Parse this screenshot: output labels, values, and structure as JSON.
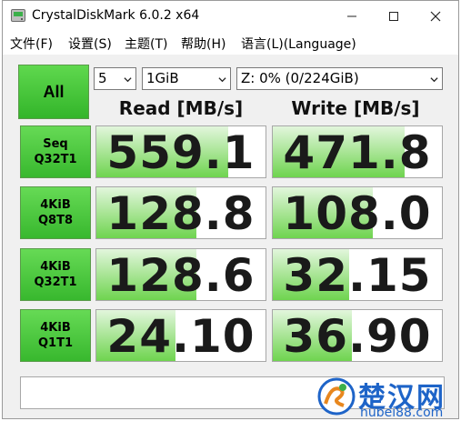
{
  "window": {
    "title": "CrystalDiskMark 6.0.2 x64",
    "controls": {
      "minimize": "minimize-icon",
      "maximize": "maximize-icon",
      "close": "close-icon"
    }
  },
  "menu": [
    {
      "label": "文件(F)"
    },
    {
      "label": "设置(S)"
    },
    {
      "label": "主题(T)"
    },
    {
      "label": "帮助(H)"
    },
    {
      "label": "语言(L)(Language)"
    }
  ],
  "toolbar": {
    "all_label": "All",
    "count_value": "5",
    "size_value": "1GiB",
    "drive_value": "Z: 0% (0/224GiB)"
  },
  "headers": {
    "read": "Read [MB/s]",
    "write": "Write [MB/s]"
  },
  "tests": [
    {
      "line1": "Seq",
      "line2": "Q32T1",
      "read": "559.1",
      "write": "471.8",
      "read_level": 0.78,
      "write_level": 0.78
    },
    {
      "line1": "4KiB",
      "line2": "Q8T8",
      "read": "128.8",
      "write": "108.0",
      "read_level": 0.59,
      "write_level": 0.59
    },
    {
      "line1": "4KiB",
      "line2": "Q32T1",
      "read": "128.6",
      "write": "32.15",
      "read_level": 0.59,
      "write_level": 0.45
    },
    {
      "line1": "4KiB",
      "line2": "Q1T1",
      "read": "24.10",
      "write": "36.90",
      "read_level": 0.47,
      "write_level": 0.47
    }
  ],
  "comment": "",
  "watermark": {
    "text": "楚汉网",
    "url": "hubei88.com"
  },
  "colors": {
    "accent_green": "#38b82e",
    "fill_green": "#6fd44f",
    "watermark_blue": "#1e64c8"
  }
}
